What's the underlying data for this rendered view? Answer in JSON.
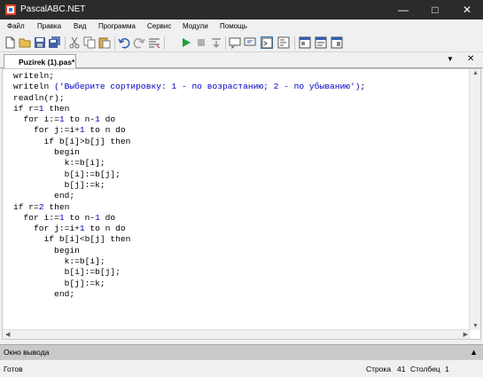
{
  "window": {
    "title": "PascalABC.NET"
  },
  "menu": [
    "Файл",
    "Правка",
    "Вид",
    "Программа",
    "Сервис",
    "Модули",
    "Помощь"
  ],
  "toolbar": [
    {
      "icon": "new-file-icon"
    },
    {
      "icon": "open-folder-icon"
    },
    {
      "icon": "save-icon"
    },
    {
      "icon": "save-all-icon"
    },
    {
      "icon": "cut-icon"
    },
    {
      "icon": "copy-icon"
    },
    {
      "icon": "paste-icon"
    },
    {
      "icon": "undo-icon"
    },
    {
      "icon": "redo-icon"
    },
    {
      "icon": "format-code-icon"
    },
    {
      "icon": "run-icon"
    },
    {
      "icon": "stop-icon"
    },
    {
      "icon": "step-into-icon"
    },
    {
      "icon": "comment-icon"
    },
    {
      "icon": "uncomment-icon"
    },
    {
      "icon": "output-window-icon",
      "pressed": true
    },
    {
      "icon": "debug-icon"
    },
    {
      "icon": "form-designer-icon"
    },
    {
      "icon": "form-code-icon"
    },
    {
      "icon": "form-view-icon"
    }
  ],
  "tab": {
    "label": "Puzirek (1).pas*"
  },
  "code_lines": [
    [
      "writeln;"
    ],
    [
      "writeln ",
      "('Выберите сортировку: 1 - по возрастанию; 2 - по убыванию')",
      ";"
    ],
    [
      "readln(r);"
    ],
    [
      "if r=",
      "1",
      " then"
    ],
    [
      "  for i:=",
      "1",
      " to n-",
      "1",
      " do"
    ],
    [
      "    for j:=i+",
      "1",
      " to n do"
    ],
    [
      "      if b[i]>b[j] then"
    ],
    [
      "        begin"
    ],
    [
      "          k:=b[i];"
    ],
    [
      "          b[i]:=b[j];"
    ],
    [
      "          b[j]:=k;"
    ],
    [
      "        end;"
    ],
    [
      "if r=",
      "2",
      " then"
    ],
    [
      "  for i:=",
      "1",
      " to n-",
      "1",
      " do"
    ],
    [
      "    for j:=i+",
      "1",
      " to n do"
    ],
    [
      "      if b[i]<b[j] then"
    ],
    [
      "        begin"
    ],
    [
      "          k:=b[i];"
    ],
    [
      "          b[i]:=b[j];"
    ],
    [
      "          b[j]:=k;"
    ],
    [
      "        end;"
    ]
  ],
  "output_panel": {
    "label": "Окно вывода"
  },
  "status": {
    "state": "Готов",
    "row_label": "Строка",
    "row": "41",
    "col_label": "Столбец",
    "col": "1"
  },
  "colors": {
    "titlebar": "#2b2b2b",
    "code_string": "#0000c0",
    "code_number": "#0000c0",
    "code_text": "#000000",
    "pressed_button": "#dceaf7"
  }
}
